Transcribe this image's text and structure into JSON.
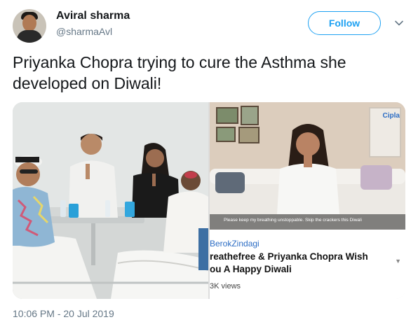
{
  "author": {
    "name": "Aviral sharma",
    "handle": "@sharmaAvl"
  },
  "follow_label": "Follow",
  "tweet": {
    "text": "Priyanka Chopra trying to cure the Asthma she developed on Diwali!",
    "timestamp": "10:06 PM - 20 Jul 2019"
  },
  "video_card": {
    "brand": "Cipla",
    "caption": "Please keep my breathing unstoppable. Skip the crackers this Diwali",
    "channel": "BerokZindagi",
    "title": "reathefree & Priyanka Chopra Wish\nou A Happy Diwali",
    "views": "3K views"
  },
  "icons": {
    "more": "chevron-down-icon"
  },
  "colors": {
    "accent": "#1da1f2",
    "secondary_text": "#657786",
    "link_blue": "#2b6cc4"
  }
}
